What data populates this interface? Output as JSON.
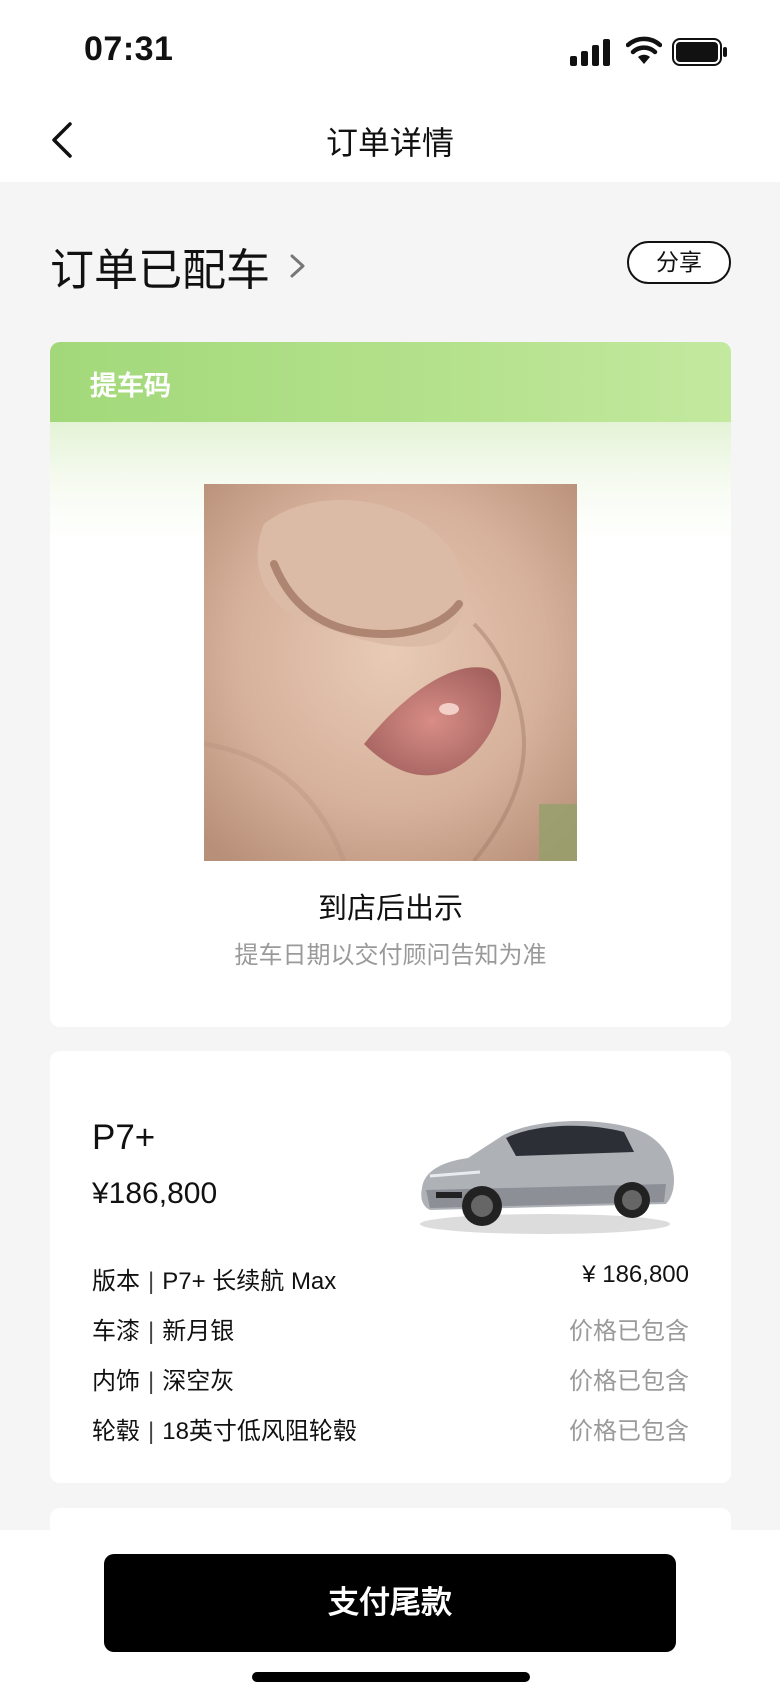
{
  "status_bar": {
    "time": "07:31",
    "icons": [
      "signal-icon",
      "wifi-icon",
      "battery-icon"
    ]
  },
  "nav": {
    "back_icon": "chevron-left-icon",
    "title": "订单详情"
  },
  "order": {
    "status": "订单已配车",
    "share_label": "分享"
  },
  "pickup": {
    "header_label": "提车码",
    "instruction": "到店后出示",
    "note": "提车日期以交付顾问告知为准"
  },
  "car": {
    "model": "P7+",
    "price": "¥186,800",
    "specs": [
      {
        "label": "版本",
        "value": "P7+ 长续航 Max",
        "price": "¥ 186,800"
      },
      {
        "label": "车漆",
        "value": "新月银",
        "price": "价格已包含"
      },
      {
        "label": "内饰",
        "value": "深空灰",
        "price": "价格已包含"
      },
      {
        "label": "轮毂",
        "value": "18英寸低风阻轮毂",
        "price": "价格已包含"
      }
    ],
    "separator": "|"
  },
  "footer": {
    "pay_label": "支付尾款"
  },
  "colors": {
    "accent_green": "#a2d87a",
    "primary_button": "#000000",
    "muted_text": "#9a9a9a",
    "background": "#f5f5f6"
  }
}
